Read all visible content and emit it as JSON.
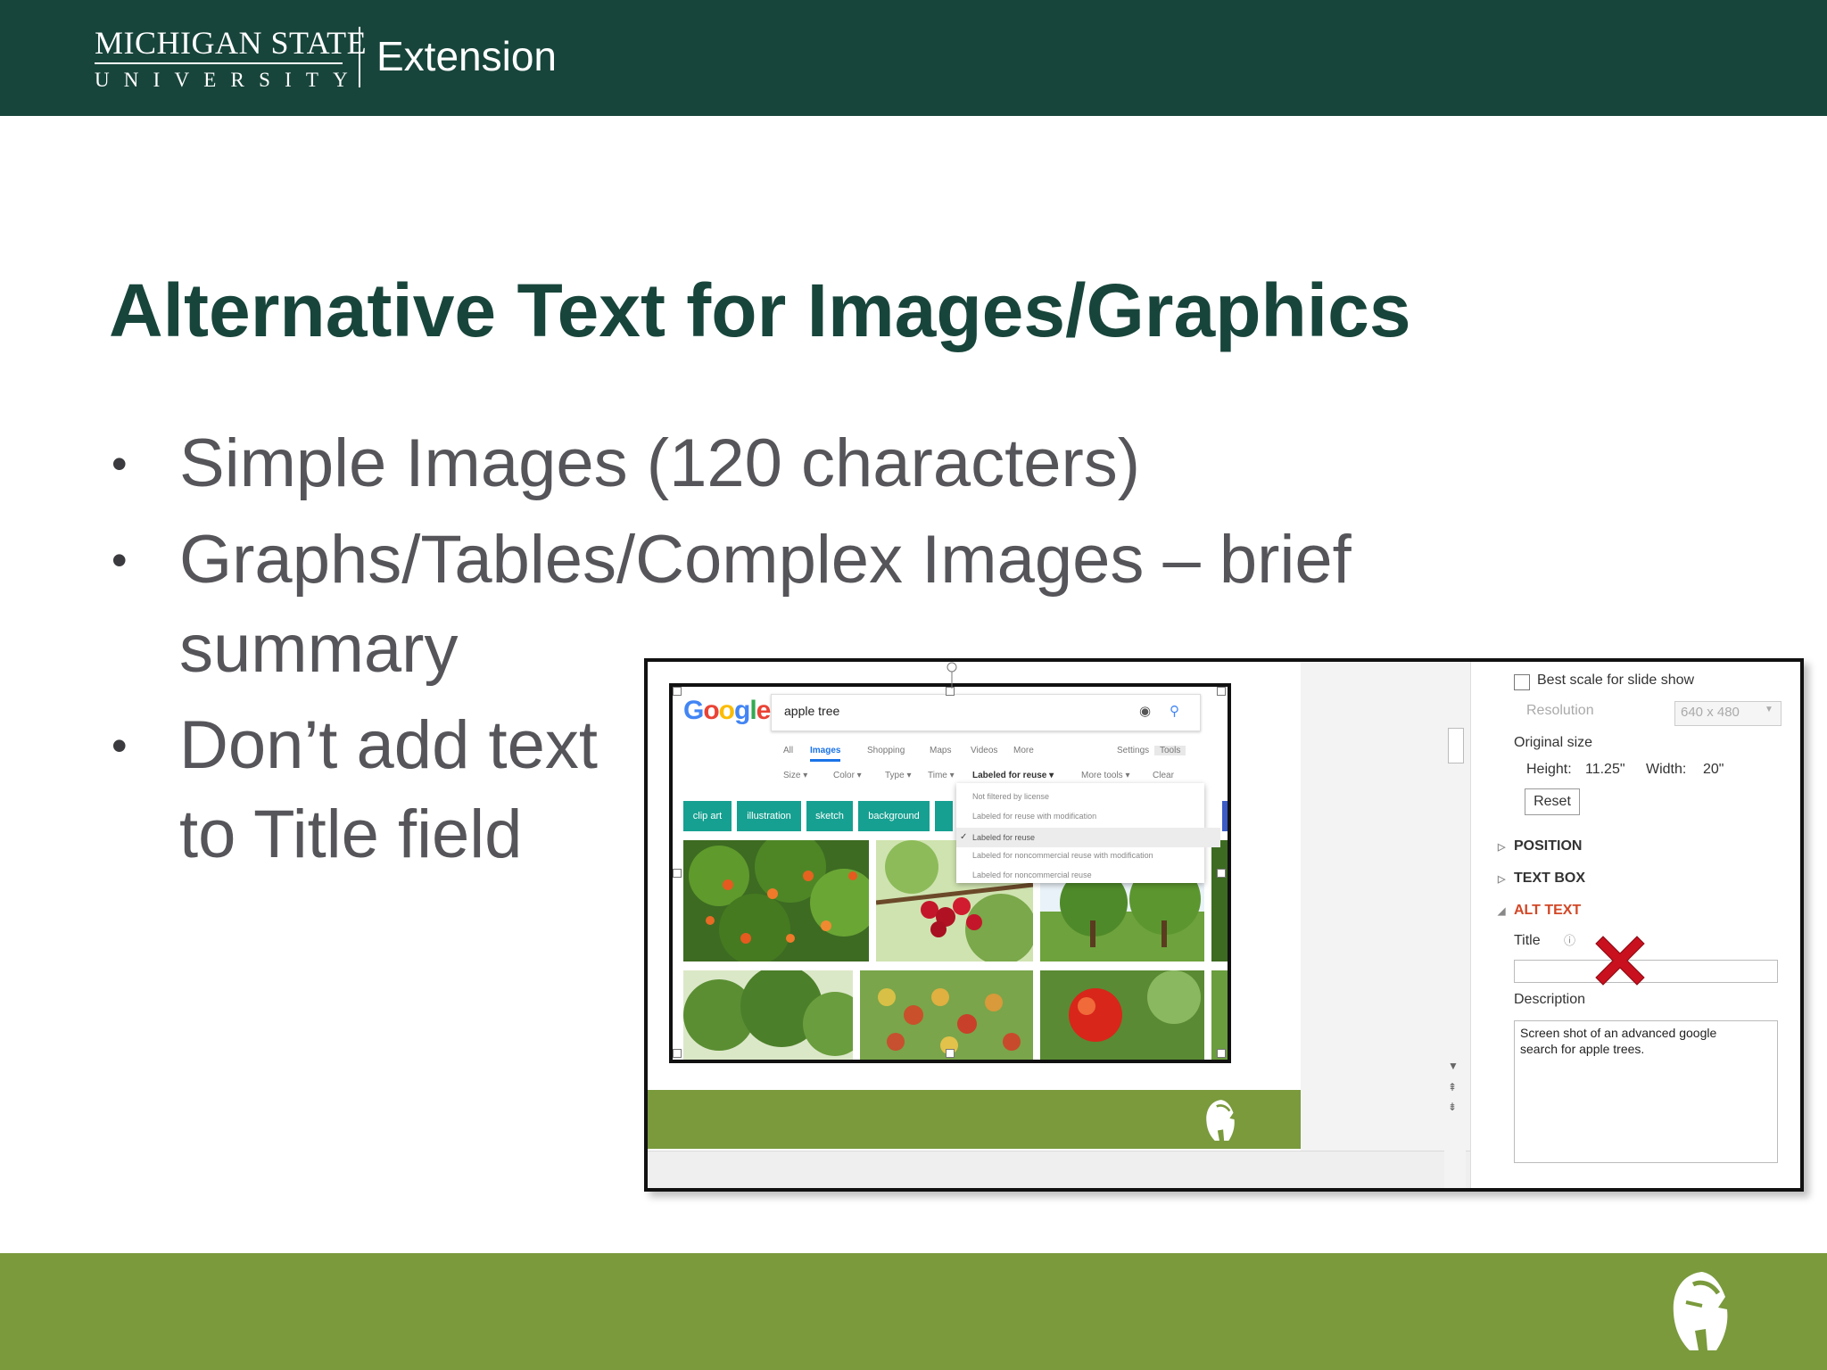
{
  "header": {
    "university_line1": "MICHIGAN STATE",
    "university_line2": "UNIVERSITY",
    "extension_label": "Extension"
  },
  "slide": {
    "title": "Alternative Text for Images/Graphics",
    "bullets": [
      {
        "line1": "Simple Images (120 characters)",
        "line2": ""
      },
      {
        "line1": "Graphs/Tables/Complex Images – brief",
        "line2": "summary"
      },
      {
        "line1": "Don’t add text",
        "line2": "to Title field"
      }
    ]
  },
  "screenshot": {
    "google": {
      "logo_letters": [
        "G",
        "o",
        "o",
        "g",
        "l",
        "e"
      ],
      "query": "apple tree",
      "tabs": [
        "All",
        "Images",
        "Shopping",
        "Maps",
        "Videos",
        "More",
        "Settings",
        "Tools"
      ],
      "active_tab": "Images",
      "tools": [
        "Size ▾",
        "Color ▾",
        "Type ▾",
        "Time ▾",
        "Labeled for reuse ▾",
        "More tools ▾",
        "Clear"
      ],
      "license_options": [
        "Not filtered by license",
        "Labeled for reuse with modification",
        "Labeled for reuse",
        "Labeled for noncommercial reuse with modification",
        "Labeled for noncommercial reuse"
      ],
      "selected_option": "Labeled for reuse",
      "chips": [
        "clip art",
        "illustration",
        "sketch",
        "background"
      ]
    },
    "panel": {
      "best_scale_label": "Best scale for slide show",
      "resolution_label": "Resolution",
      "resolution_value": "640 x 480",
      "original_size_label": "Original size",
      "height_label": "Height:",
      "height_value": "11.25\"",
      "width_label": "Width:",
      "width_value": "20\"",
      "reset_label": "Reset",
      "sections": [
        "POSITION",
        "TEXT BOX",
        "ALT TEXT"
      ],
      "title_label": "Title",
      "description_label": "Description",
      "description_value": "Screen shot of an advanced google\nsearch for apple trees."
    },
    "colors": {
      "msu_green": "#18453b",
      "accent_green": "#7a9a3c",
      "alt_text_red": "#d24726",
      "x_mark": "#c8101e"
    }
  }
}
